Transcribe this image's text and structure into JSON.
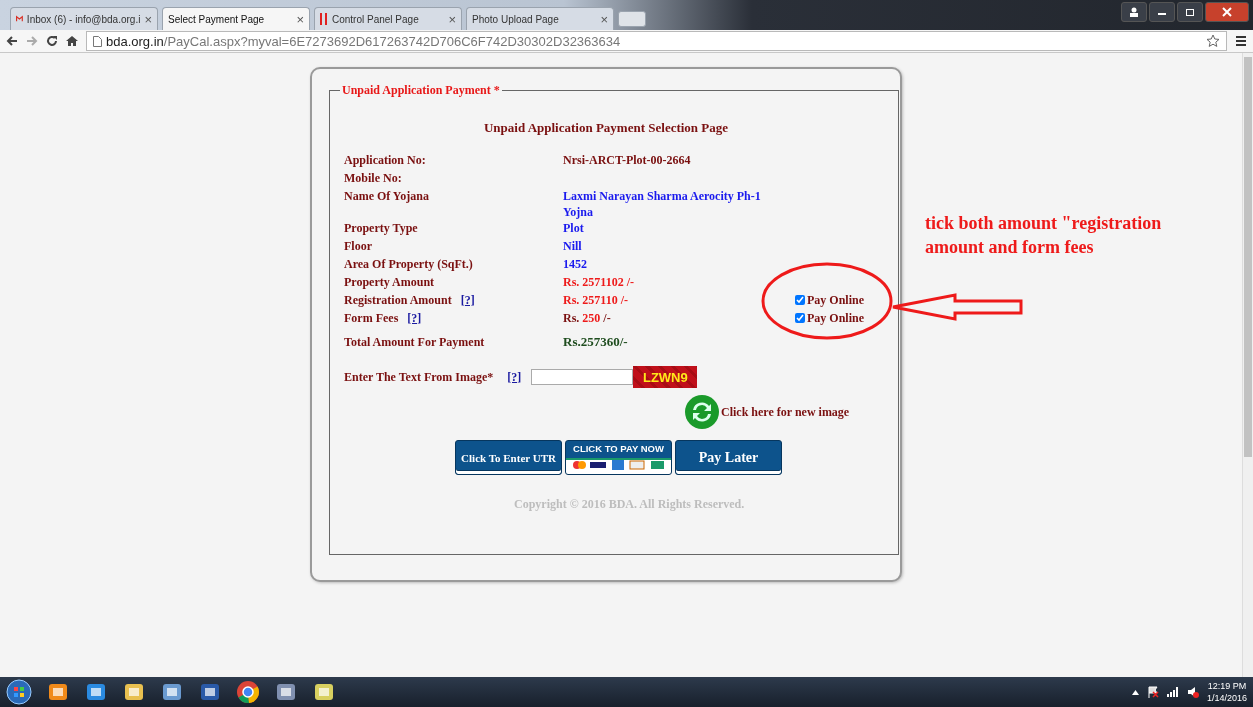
{
  "browser": {
    "tabs": [
      {
        "title": "Inbox (6) - info@bda.org.i",
        "kind": "mail",
        "selected": false
      },
      {
        "title": "Select Payment Page",
        "kind": "page",
        "selected": true
      },
      {
        "title": "Control Panel Page",
        "kind": "bars",
        "selected": false
      },
      {
        "title": "Photo Upload Page",
        "kind": "page",
        "selected": false
      }
    ],
    "tab_close": "×",
    "url_host": "bda.org.in",
    "url_path": "/PayCal.aspx?myval=6E7273692D617263742D706C6F742D30302D32363634"
  },
  "form": {
    "legend": "Unpaid Application Payment *",
    "heading": "Unpaid Application Payment Selection Page",
    "rows": [
      {
        "kind": "field",
        "label": "Application No:",
        "value": [
          {
            "text": "Nrsi-ARCT-Plot-00-2664",
            "color": "#7a1010"
          }
        ]
      },
      {
        "kind": "field",
        "label": "Mobile No:"
      },
      {
        "kind": "field",
        "label": "Name Of Yojana",
        "value": [
          {
            "text": "Laxmi Narayan Sharma Aerocity Ph-1 Yojna",
            "color": "#1a1aee"
          }
        ]
      },
      {
        "kind": "field",
        "label": "Property Type",
        "value": [
          {
            "text": "Plot",
            "color": "#1a1aee"
          }
        ]
      },
      {
        "kind": "field",
        "label": "Floor",
        "value": [
          {
            "text": "Nill",
            "color": "#1a1aee"
          }
        ]
      },
      {
        "kind": "field",
        "label": "Area Of Property (SqFt.)",
        "value": [
          {
            "text": "1452",
            "color": "#1a1aee"
          }
        ]
      },
      {
        "kind": "field",
        "label": "Property Amount",
        "value": [
          {
            "text": "Rs. 2571102 /-",
            "color": "#ee1a1a"
          }
        ]
      },
      {
        "kind": "field",
        "label": "Registration Amount",
        "help": "[?]",
        "value": [
          {
            "text": "Rs. 257110 /-",
            "color": "#ee1a1a"
          }
        ],
        "option": {
          "label": "Pay Online",
          "checked": true
        }
      },
      {
        "kind": "field",
        "label": "Form Fees",
        "help": "[?]",
        "value": [
          {
            "text": "Rs. ",
            "color": "#7a1010"
          },
          {
            "text": "250",
            "color": "#ee1a1a"
          },
          {
            "text": " /-",
            "color": "#7a1010"
          }
        ],
        "option": {
          "label": "Pay Online",
          "checked": true
        }
      },
      {
        "kind": "total",
        "label": "Total Amount For Payment",
        "value": [
          {
            "text": "Rs.257360/-",
            "color": "#1f4d1f"
          }
        ]
      }
    ],
    "captcha_label": "Enter The Text From Image*",
    "captcha_help": "[?]",
    "captcha_text": "LZWN9",
    "refresh_label": "Click here for new image",
    "buttons": [
      {
        "kind": "text",
        "label": "Click To Enter UTR"
      },
      {
        "kind": "cards",
        "label": "CLICK TO PAY NOW"
      },
      {
        "kind": "big",
        "label": "Pay Later"
      }
    ],
    "copyright": "Copyright © 2016 BDA. All Rights Reserved."
  },
  "annotation": {
    "text": "tick both amount \"registration amount and form fees"
  },
  "taskbar": {
    "time": "12:19 PM",
    "date": "1/14/2016"
  }
}
